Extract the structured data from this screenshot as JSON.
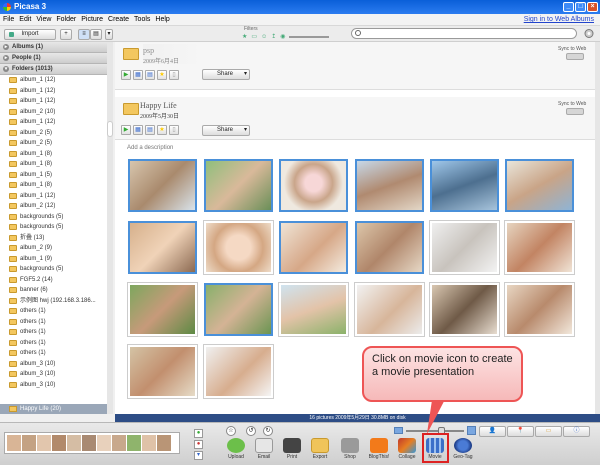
{
  "window": {
    "title": "Picasa 3"
  },
  "menu": {
    "items": [
      "File",
      "Edit",
      "View",
      "Folder",
      "Picture",
      "Create",
      "Tools",
      "Help"
    ],
    "signin": "Sign in to Web Albums"
  },
  "toolbar": {
    "import_label": "Import"
  },
  "filters": {
    "label": "Filters"
  },
  "search": {
    "placeholder": ""
  },
  "sidebar": {
    "categories": [
      {
        "label": "Albums (1)"
      },
      {
        "label": "People (1)"
      },
      {
        "label": "Folders (1013)"
      }
    ],
    "folders": [
      "album_1 (12)",
      "album_1 (12)",
      "album_1 (12)",
      "album_2 (10)",
      "album_1 (12)",
      "album_2 (5)",
      "album_2 (5)",
      "album_1 (8)",
      "album_1 (8)",
      "album_1 (5)",
      "album_1 (8)",
      "album_1 (12)",
      "album_2 (12)",
      "backgrounds (5)",
      "backgrounds (5)",
      "折叠 (13)",
      "album_2 (9)",
      "album_1 (9)",
      "backgrounds (5)",
      "FGF5.2 (14)",
      "banner (6)",
      "示例图 hwj (192.168.3.186...",
      "others (1)",
      "others (1)",
      "others (1)",
      "others (1)",
      "others (1)",
      "album_3 (10)",
      "album_3 (10)",
      "album_3 (10)"
    ],
    "selected": "Happy Life (20)"
  },
  "albums": [
    {
      "title": "psp",
      "date": "2009年6月4日",
      "share_label": "Share",
      "sync_label": "Sync to Web"
    },
    {
      "title": "Happy Life",
      "date": "2009年5月30日",
      "share_label": "Share",
      "sync_label": "Sync to Web",
      "description": "Add a description"
    }
  ],
  "status": {
    "text": "16 pictures   2009年5月29日   30.8MB on disk"
  },
  "bottom_buttons": [
    {
      "label": "Upload"
    },
    {
      "label": "Email"
    },
    {
      "label": "Print"
    },
    {
      "label": "Export"
    },
    {
      "label": "Shop"
    },
    {
      "label": "BlogThis!"
    },
    {
      "label": "Collage"
    },
    {
      "label": "Movie"
    },
    {
      "label": "Geo-Tag"
    }
  ],
  "callout": {
    "text": "Click on movie icon to create a movie presentation"
  },
  "colors": {
    "titlebar": "#0a5fd8",
    "statusbar": "#2d4d86",
    "callout_border": "#e55555",
    "highlight": "#dd2222"
  }
}
